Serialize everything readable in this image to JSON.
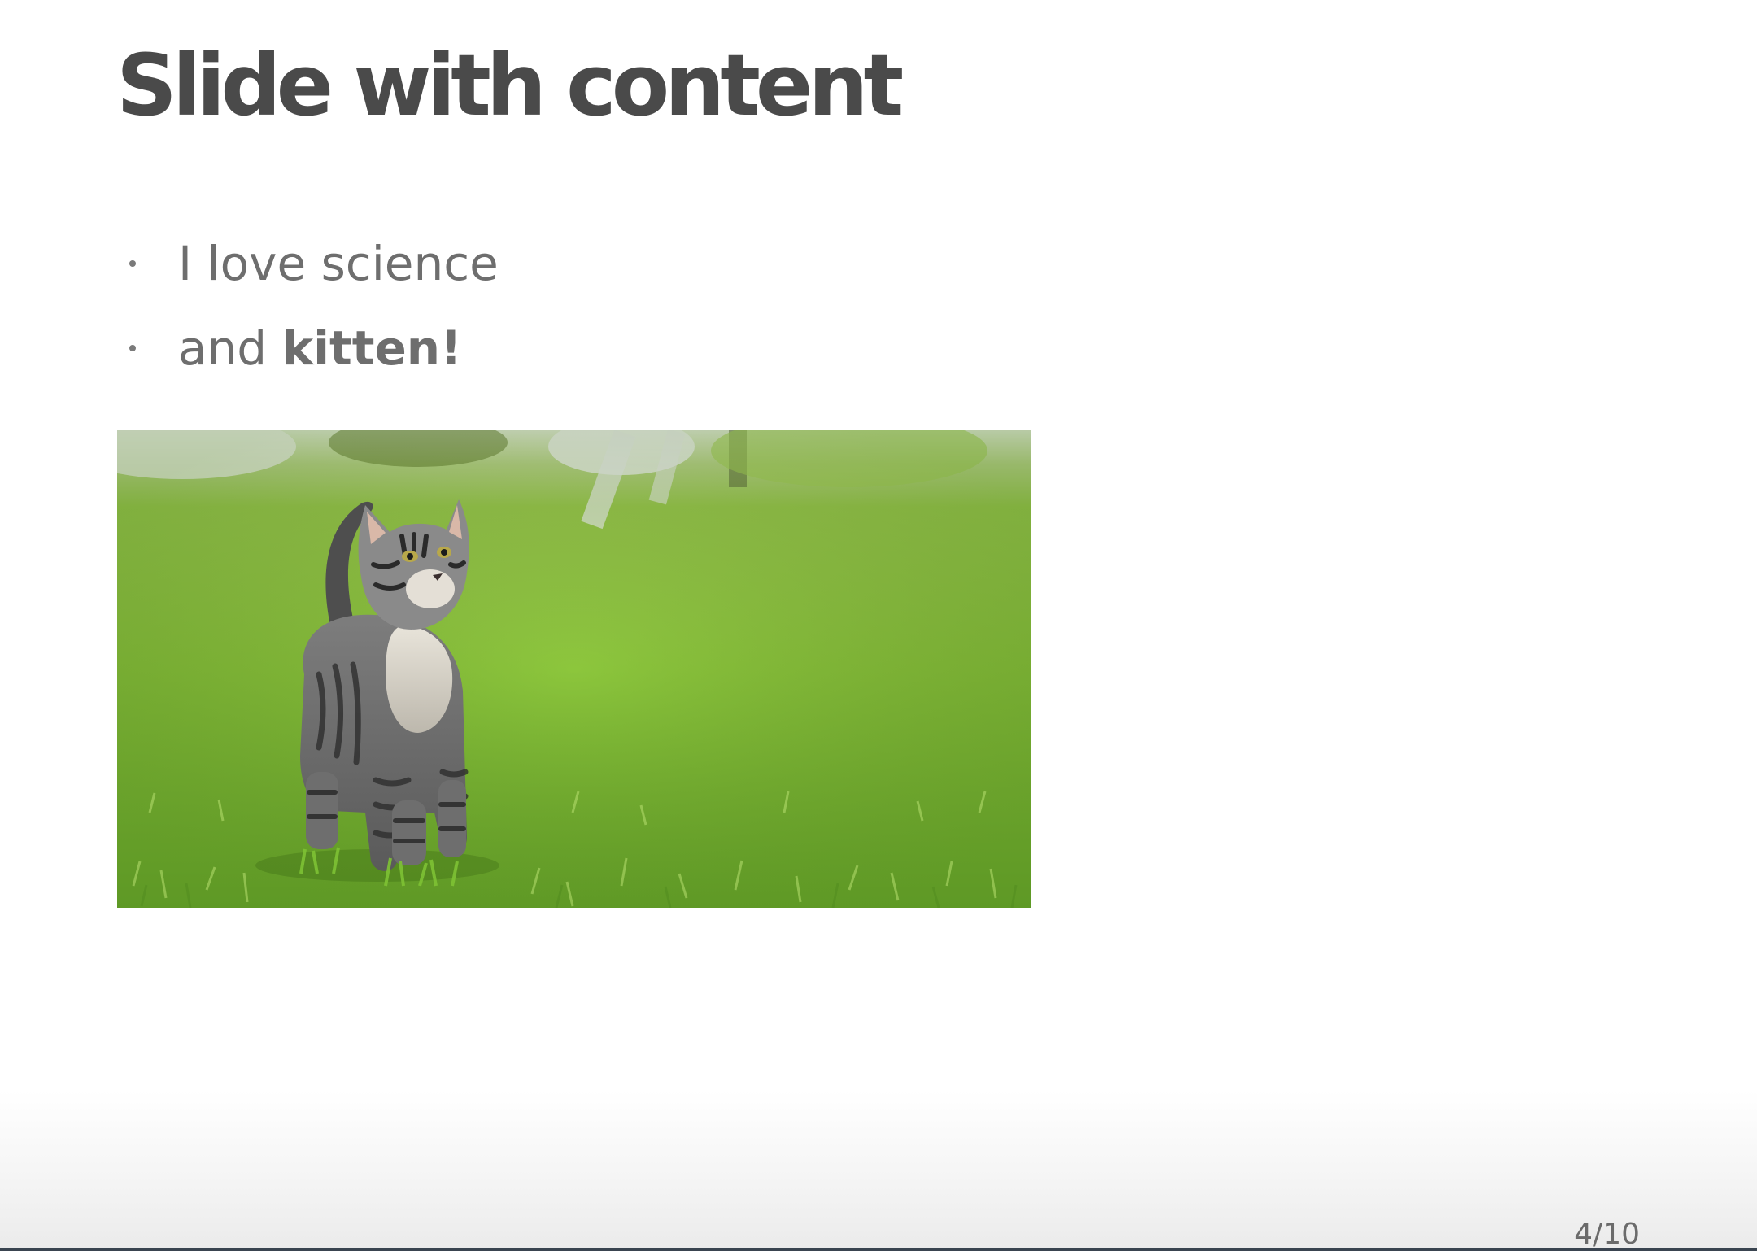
{
  "slide": {
    "title": "Slide with content",
    "bullets": [
      {
        "text": "I love science",
        "bold": ""
      },
      {
        "text": "and ",
        "bold": "kitten!"
      }
    ],
    "image": {
      "subject": "tabby kitten standing in green grass",
      "icon": "photo-image"
    },
    "page_number": "4/10"
  },
  "colors": {
    "title": "#4a4a4a",
    "body_text": "#6e6e6e",
    "background": "#ffffff",
    "grass": "#86c43a",
    "footer_line": "#3a4450"
  }
}
